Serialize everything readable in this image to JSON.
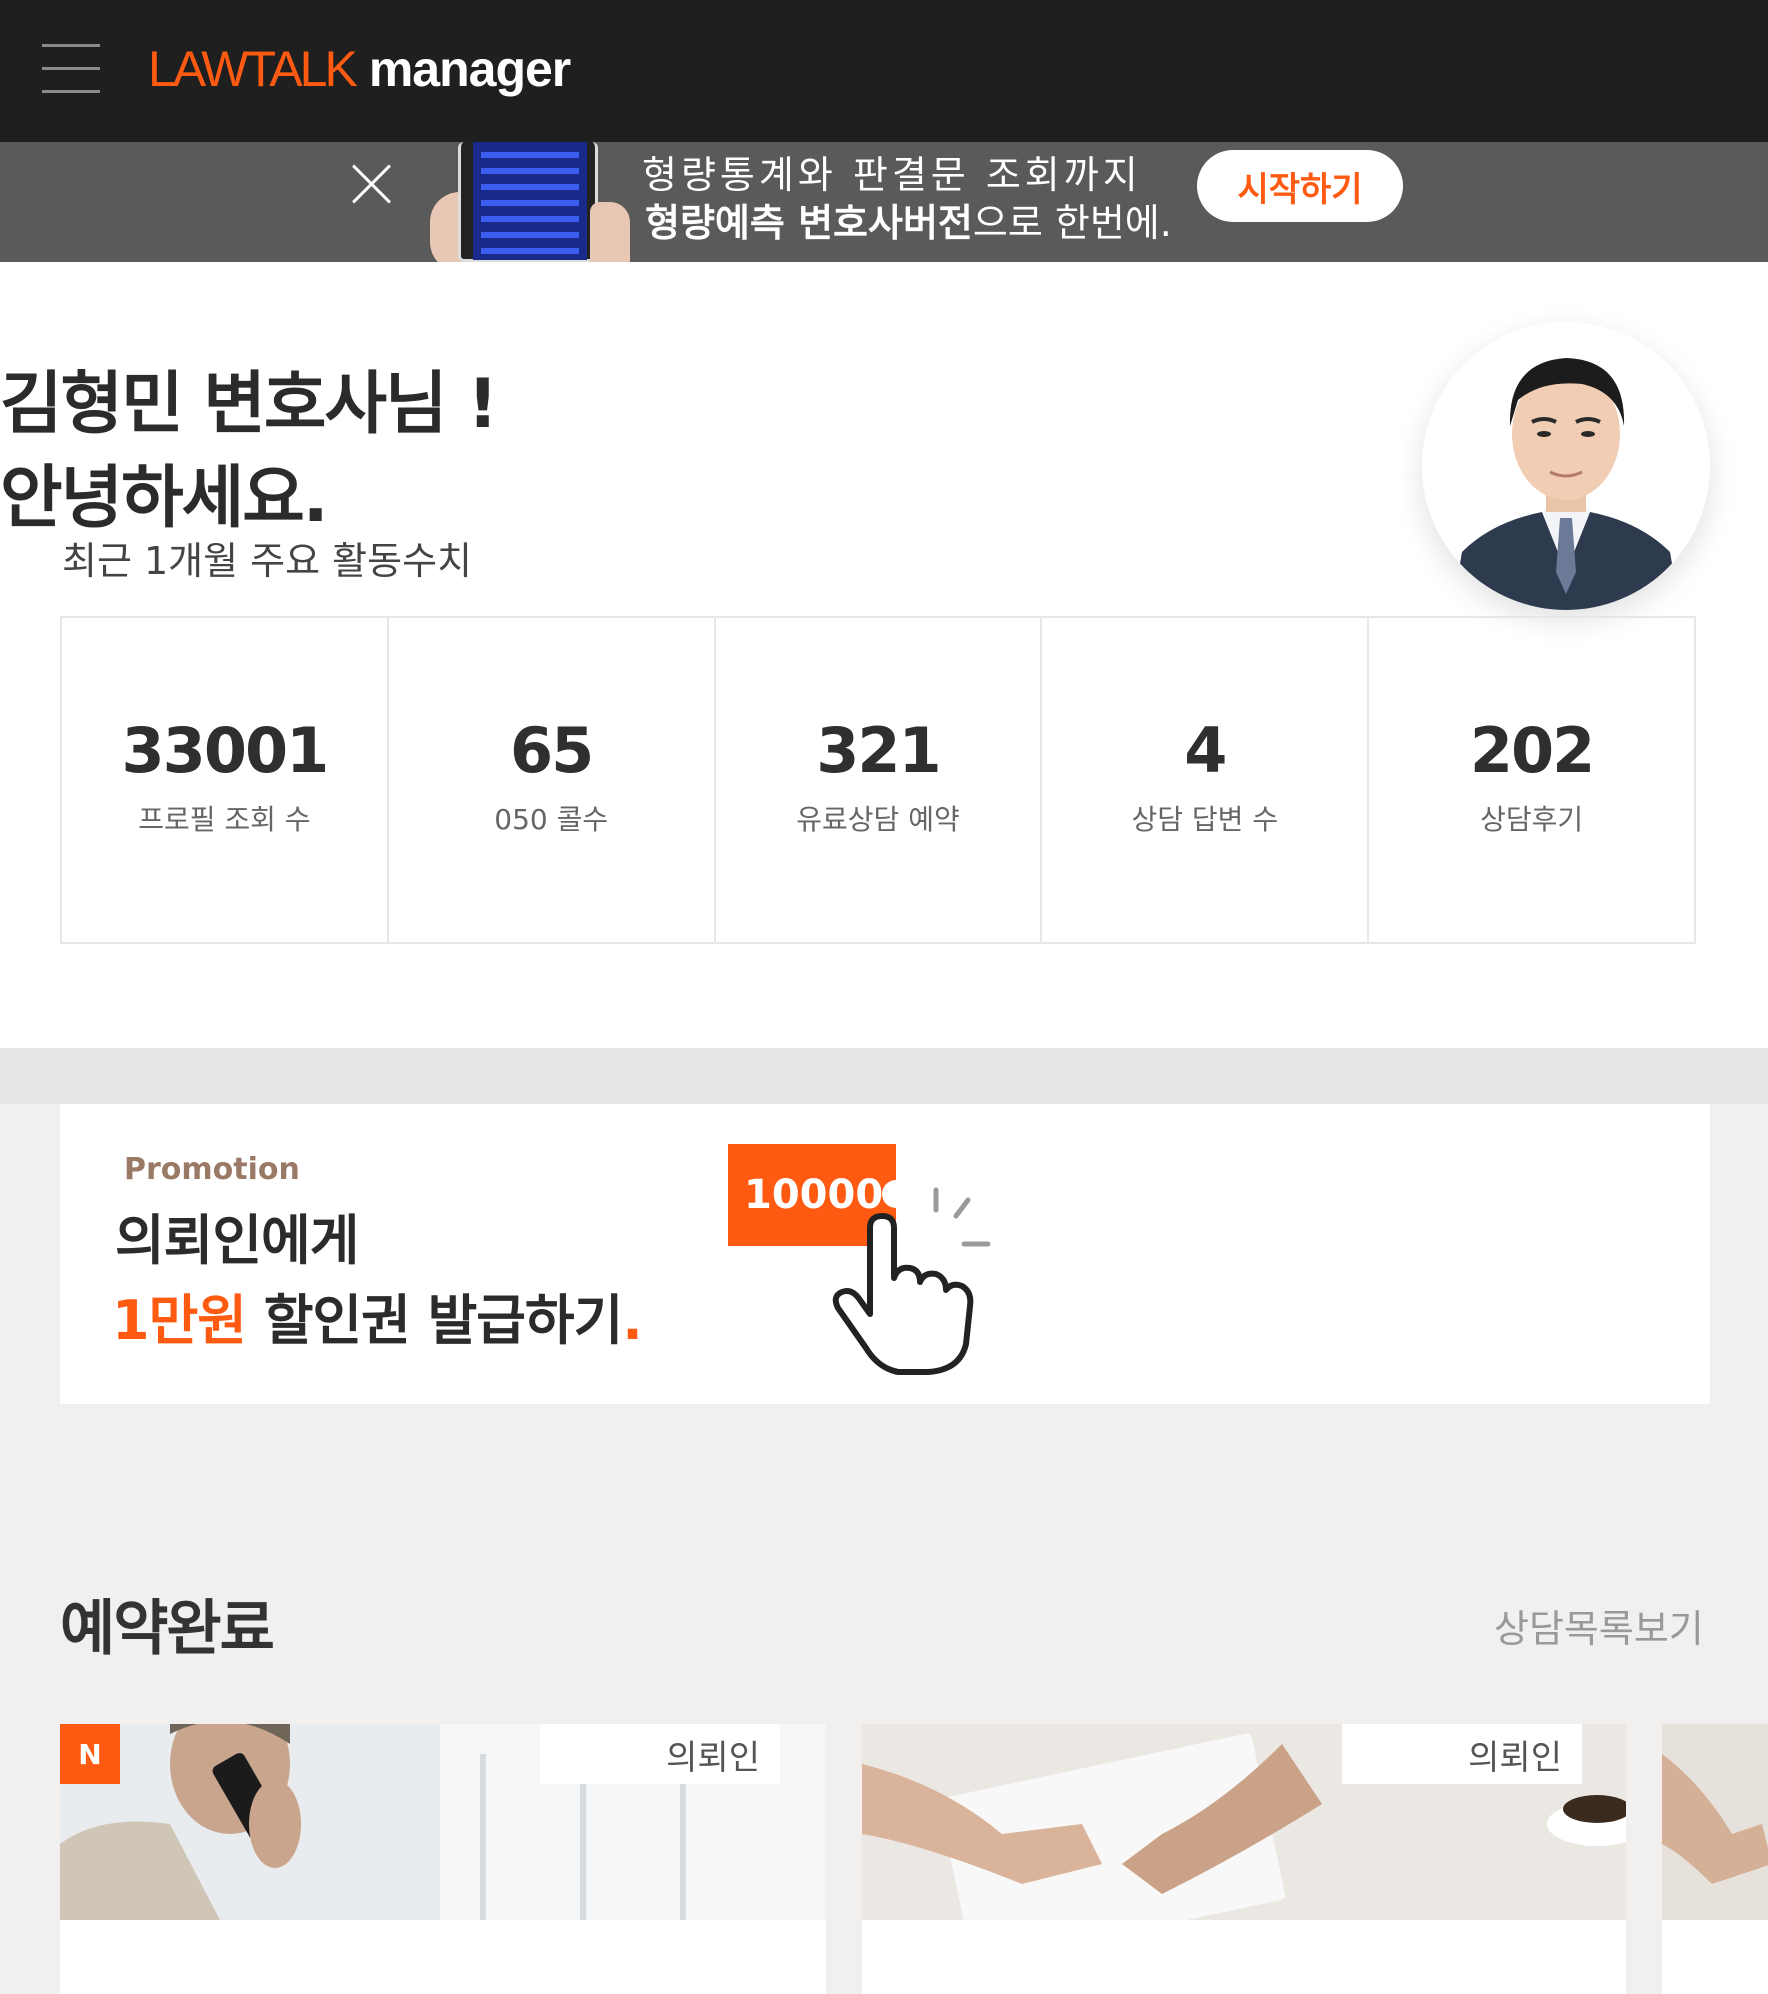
{
  "header": {
    "logo_brand": "LAWTALK",
    "logo_sub": "manager",
    "menu_icon": "hamburger-menu-icon"
  },
  "banner": {
    "line1": "형량통계와 판결문 조회까지",
    "line2_bold": "형량예측 변호사버전",
    "line2_rest": "으로 한번에.",
    "cta": "시작하기",
    "close_icon": "close-icon"
  },
  "greeting": {
    "line1": "김형민 변호사님 !",
    "line2": "안녕하세요.",
    "activity_label": "최근 1개월 주요 활동수치"
  },
  "stats": [
    {
      "value": "33001",
      "label": "프로필 조회 수"
    },
    {
      "value": "65",
      "label": "050 콜수"
    },
    {
      "value": "321",
      "label": "유료상담 예약"
    },
    {
      "value": "4",
      "label": "상담 답변 수"
    },
    {
      "value": "202",
      "label": "상담후기"
    }
  ],
  "promotion": {
    "tag": "Promotion",
    "line1": "의뢰인에게",
    "line2_highlight": "1만원",
    "line2_rest": " 할인권 발급하기",
    "line2_dot": ".",
    "coupon_value": "10000"
  },
  "reservations": {
    "title": "예약완료",
    "link": "상담목록보기",
    "cards": [
      {
        "badge": "N",
        "client": "의뢰인"
      },
      {
        "client": "의뢰인"
      }
    ]
  },
  "colors": {
    "accent": "#ff5a12",
    "header_bg": "#1f1f1f",
    "banner_bg": "#5a5a5a"
  }
}
